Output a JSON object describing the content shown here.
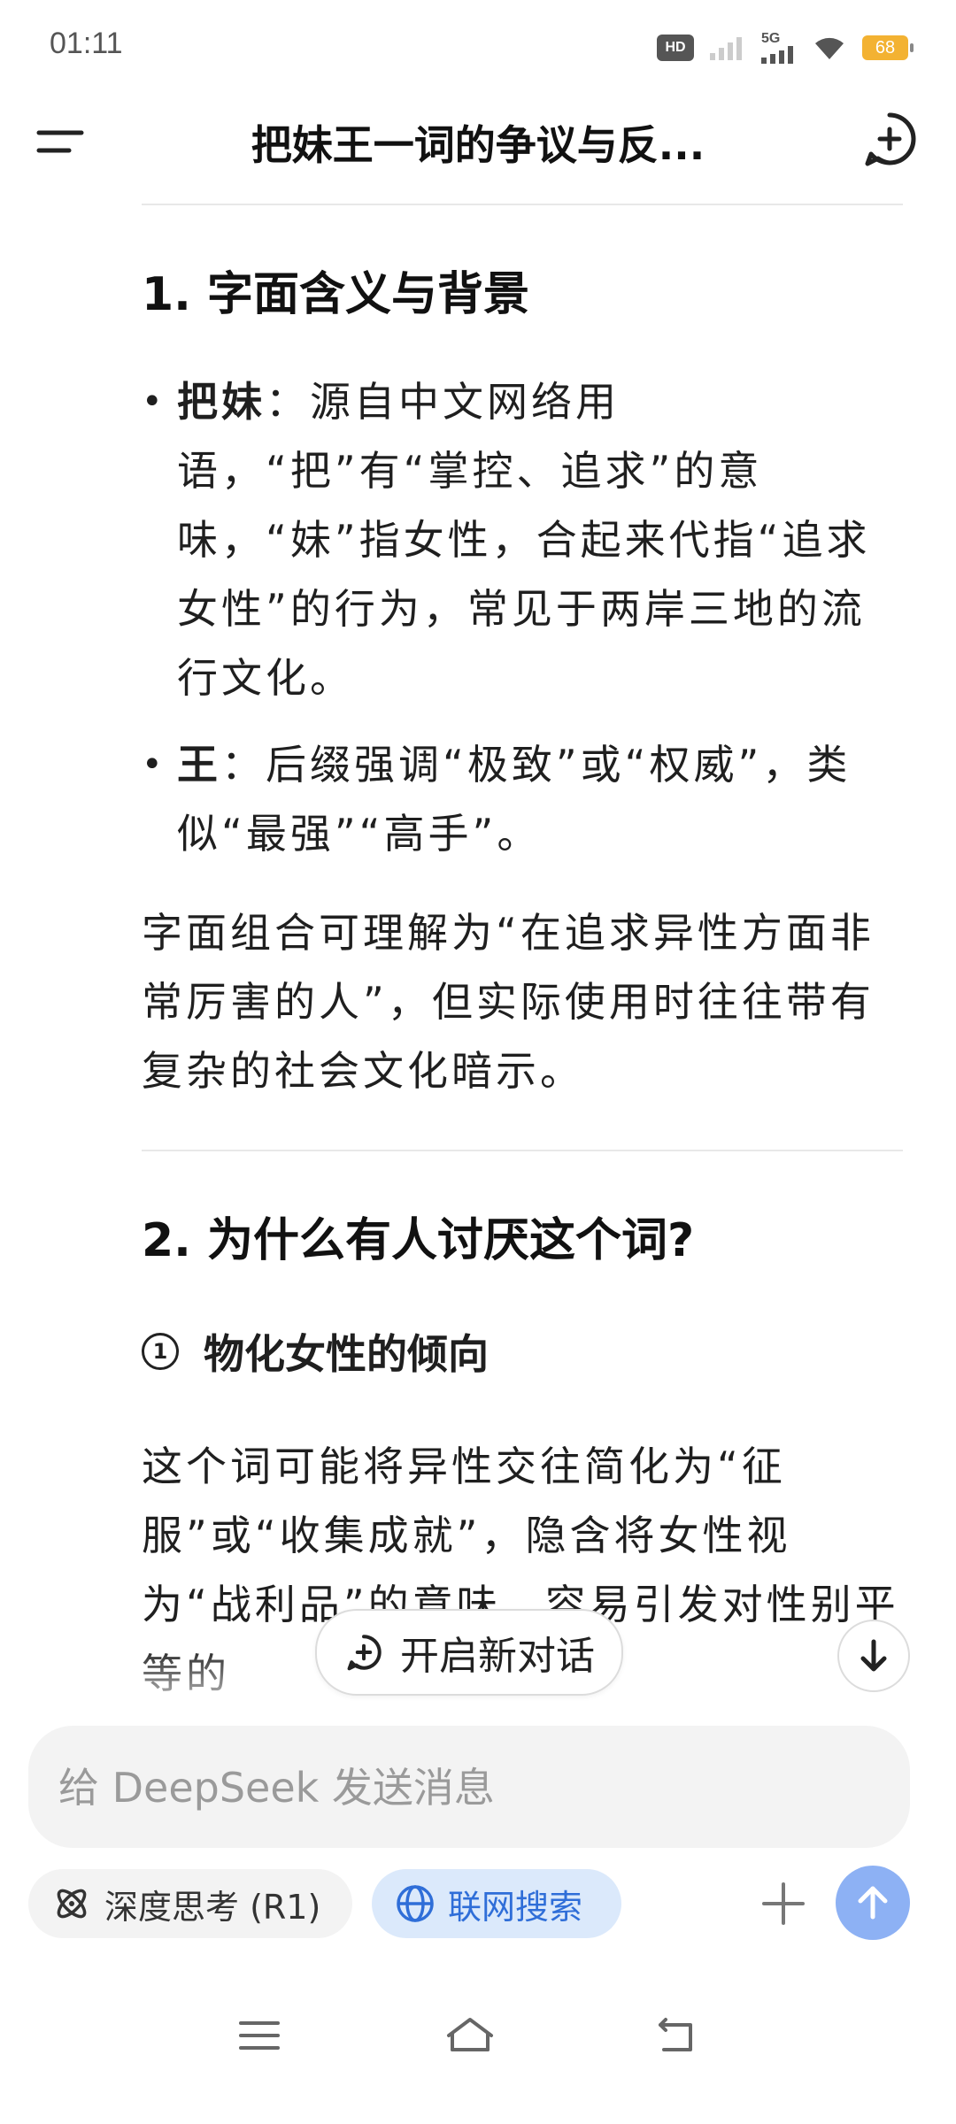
{
  "status_bar": {
    "time": "01:11",
    "hd_label": "HD",
    "network_label": "5G",
    "battery_level": "68"
  },
  "header": {
    "title": "把妹王一词的争议与反..."
  },
  "content": {
    "section1": {
      "number": "1.",
      "title": "字面含义与背景",
      "bullets": [
        {
          "term": "把妹",
          "text": "：源自中文网络用语，“把”有“掌控、追求”的意味，“妹”指女性，合起来代指“追求女性”的行为，常见于两岸三地的流行文化。"
        },
        {
          "term": "王",
          "text": "：后缀强调“极致”或“权威”，类似“最强”“高手”。"
        }
      ],
      "paragraph": "字面组合可理解为“在追求异性方面非常厉害的人”，但实际使用时往往带有复杂的社会文化暗示。"
    },
    "section2": {
      "number": "2.",
      "title": "为什么有人讨厌这个词?",
      "sub": {
        "number": "1",
        "title": "物化女性的倾向"
      },
      "paragraph": "这个词可能将异性交往简化为“征服”或“收集成就”，隐含将女性视为“战利品”的意味，容易引发对性别平等的"
    }
  },
  "floating": {
    "new_chat_label": "开启新对话"
  },
  "composer": {
    "placeholder": "给 DeepSeek 发送消息",
    "deep_think_label": "深度思考 (R1)",
    "web_search_label": "联网搜索"
  },
  "colors": {
    "accent": "#2f6ed8",
    "send_button": "#8db1f4",
    "battery": "#f3b232"
  }
}
